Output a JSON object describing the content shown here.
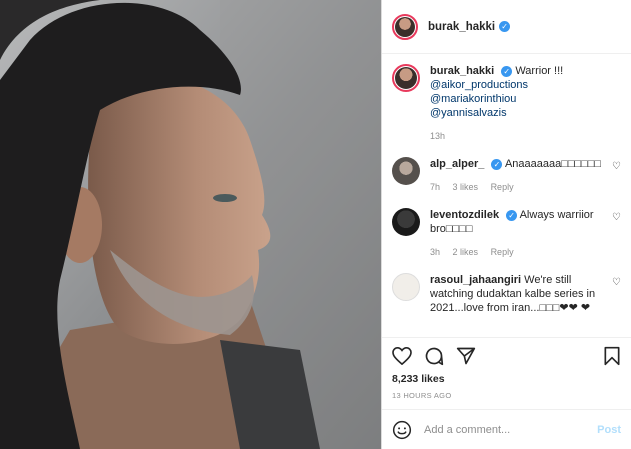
{
  "post": {
    "username": "burak_hakki",
    "caption": {
      "text": "Warrior !!!",
      "mentions": [
        "@aikor_productions",
        "@mariakorinthiou",
        "@yannisalvazis"
      ],
      "time": "13h"
    },
    "comments": [
      {
        "user": "alp_alper_",
        "verified": true,
        "text": "Anaaaaaaa□□□□□□",
        "time": "7h",
        "likes": "3 likes",
        "reply": "Reply"
      },
      {
        "user": "leventozdilek",
        "verified": true,
        "text": "Always warriior bro□□□□",
        "time": "3h",
        "likes": "2 likes",
        "reply": "Reply"
      },
      {
        "user": "rasoul_jahaangiri",
        "verified": false,
        "text": "We're still watching dudaktan kalbe series in 2021...love from iran...□□□❤❤ ❤"
      }
    ],
    "likes": "8,233 likes",
    "posted_ago": "13 HOURS AGO",
    "comment_placeholder": "Add a comment...",
    "post_label": "Post"
  },
  "icons": [
    "heart-icon",
    "comment-icon",
    "share-icon",
    "bookmark-icon",
    "emoji-icon",
    "verified-badge-icon"
  ],
  "colors": {
    "verified": "#3897f0",
    "mention": "#00376b",
    "muted": "#8e8e8e",
    "post_disabled": "#b2dffc",
    "story_ring": "#e8395c"
  }
}
